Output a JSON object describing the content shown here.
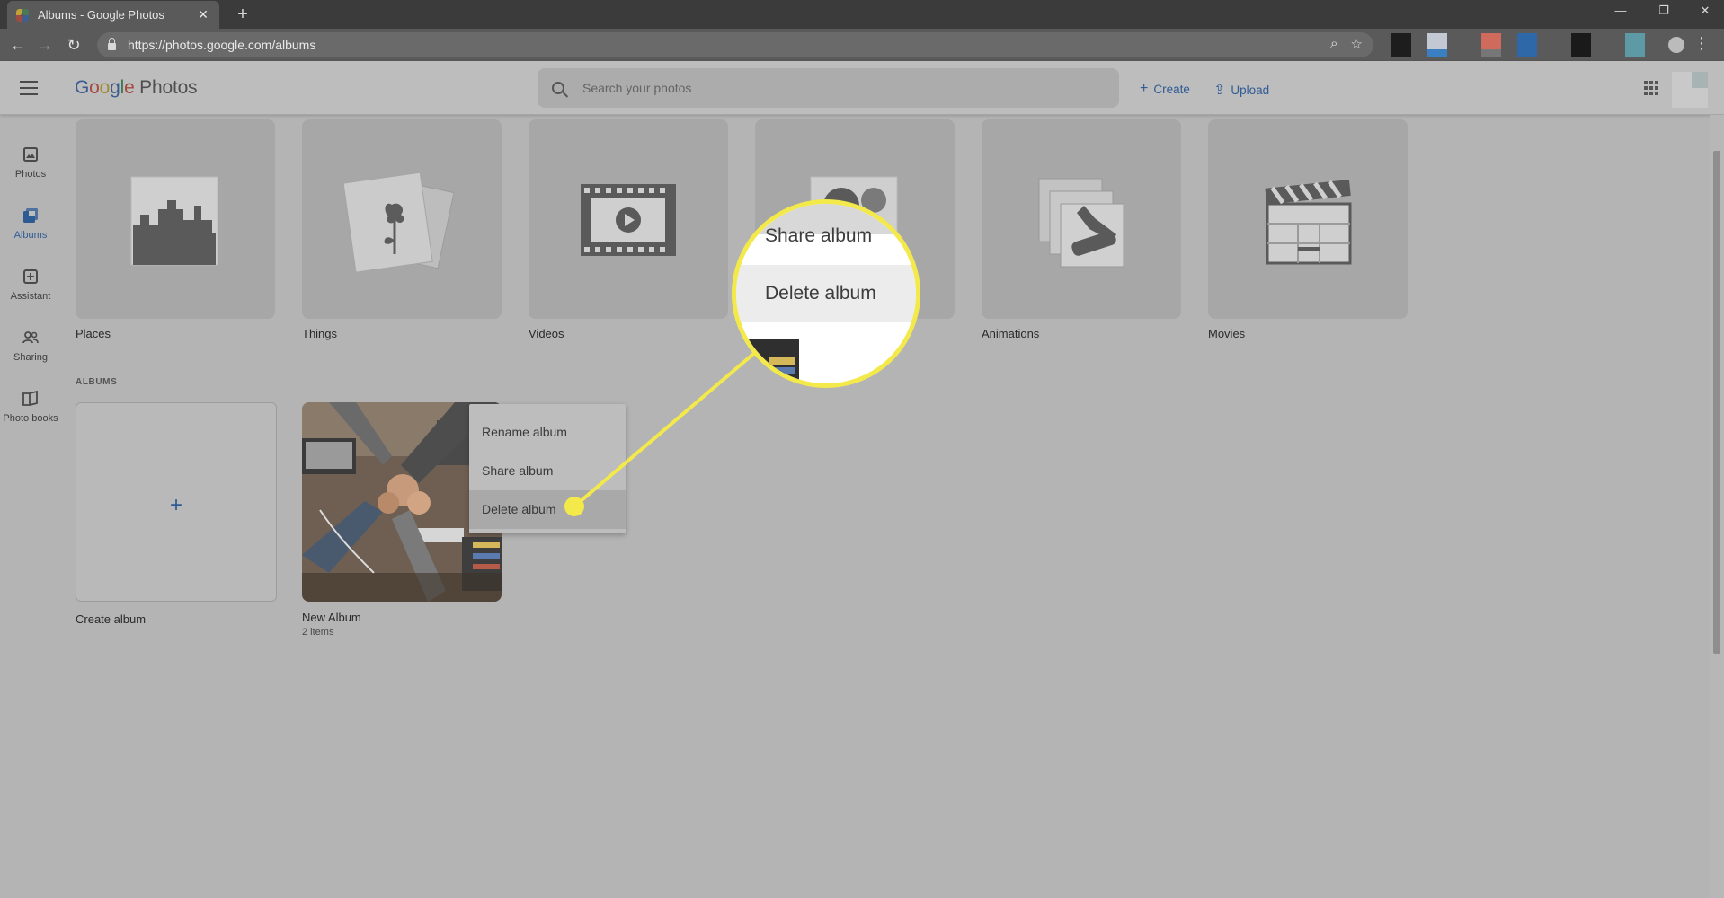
{
  "browser": {
    "tab_title": "Albums - Google Photos",
    "tab_close": "✕",
    "new_tab": "+",
    "url": "https://photos.google.com/albums",
    "minimize": "—",
    "restore": "❐",
    "close": "✕"
  },
  "header": {
    "logo": {
      "G": "G",
      "o1": "o",
      "o2": "o",
      "g": "g",
      "l": "l",
      "e": "e",
      "photos": " Photos"
    },
    "search_placeholder": "Search your photos",
    "create_label": "Create",
    "upload_label": "Upload"
  },
  "sidebar": {
    "items": [
      {
        "label": "Photos"
      },
      {
        "label": "Albums"
      },
      {
        "label": "Assistant"
      },
      {
        "label": "Sharing"
      },
      {
        "label": "Photo books"
      }
    ]
  },
  "things": [
    {
      "label": "Places"
    },
    {
      "label": "Things"
    },
    {
      "label": "Videos"
    },
    {
      "label": ""
    },
    {
      "label": "Animations"
    },
    {
      "label": "Movies"
    }
  ],
  "albums_section": {
    "title": "ALBUMS",
    "create_label": "Create album",
    "plus": "+",
    "album": {
      "title": "New Album",
      "count": "2 items"
    }
  },
  "context_menu": {
    "items": [
      "Rename album",
      "Share album",
      "Delete album"
    ]
  },
  "callout": {
    "items": [
      "Share album",
      "Delete album"
    ],
    "accent": "#f3e94a"
  }
}
